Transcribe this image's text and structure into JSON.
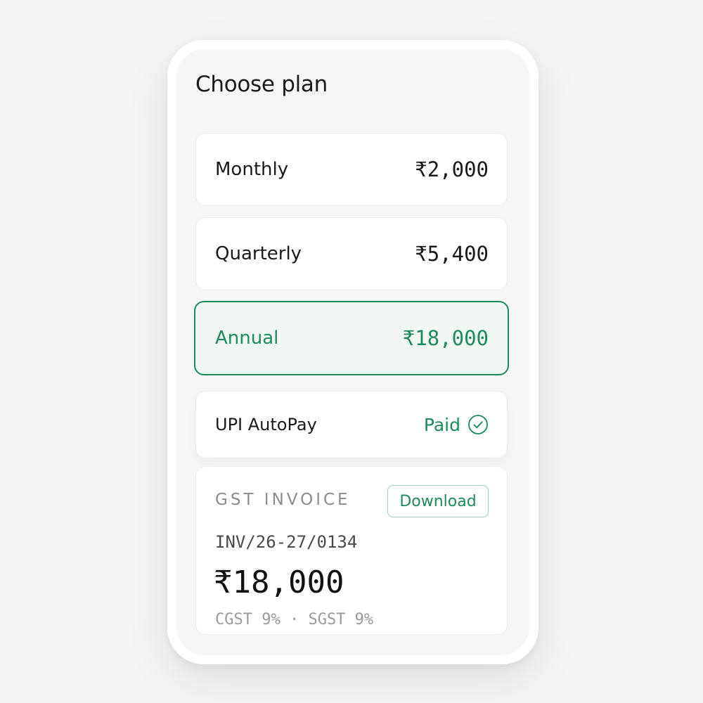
{
  "title": "Choose plan",
  "plans": [
    {
      "name": "Monthly",
      "price": "₹2,000",
      "selected": false
    },
    {
      "name": "Quarterly",
      "price": "₹5,400",
      "selected": false
    },
    {
      "name": "Annual",
      "price": "₹18,000",
      "selected": true
    }
  ],
  "payment": {
    "method": "UPI AutoPay",
    "status": "Paid",
    "status_icon": "check-circle-icon"
  },
  "invoice": {
    "label": "GST INVOICE",
    "download_label": "Download",
    "number": "INV/26-27/0134",
    "amount": "₹18,000",
    "tax_breakdown": "CGST 9% · SGST 9%"
  },
  "colors": {
    "accent": "#1f8a5b",
    "selected_background": "#f1f8f4",
    "page_background": "#f5f5f5"
  }
}
